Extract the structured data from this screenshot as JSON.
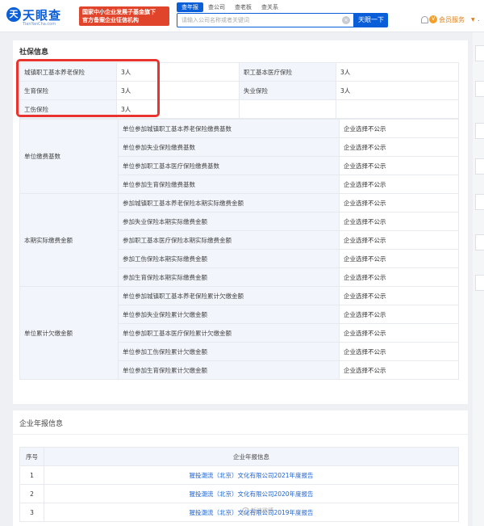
{
  "header": {
    "logo_mark": "天",
    "logo_text": "天眼查",
    "logo_sub": "TianYanCha.com",
    "badge_line1": "国家中小企业发展子基金旗下",
    "badge_line2": "官方备案企业征信机构",
    "search_tabs": [
      "查年报",
      "查公司",
      "查老板",
      "查关系"
    ],
    "search_placeholder": "请输入公司名称或者关键词",
    "clear_glyph": "×",
    "search_button": "天眼一下",
    "vip_icon": "V",
    "vip_label": "会员服务",
    "vip_caret": "▼",
    "user_trunc": "."
  },
  "social_insurance": {
    "title": "社保信息",
    "summary_rows": [
      {
        "label1": "城镇职工基本养老保险",
        "value1": "3人",
        "label2": "职工基本医疗保险",
        "value2": "3人"
      },
      {
        "label1": "生育保险",
        "value1": "3人",
        "label2": "失业保险",
        "value2": "3人"
      },
      {
        "label1": "工伤保险",
        "value1": "3人",
        "label2": "",
        "value2": ""
      }
    ],
    "groups": [
      {
        "name": "单位缴费基数",
        "items": [
          {
            "label": "单位参加城镇职工基本养老保险缴费基数",
            "value": "企业选择不公示"
          },
          {
            "label": "单位参加失业保险缴费基数",
            "value": "企业选择不公示"
          },
          {
            "label": "单位参加职工基本医疗保险缴费基数",
            "value": "企业选择不公示"
          },
          {
            "label": "单位参加生育保险缴费基数",
            "value": "企业选择不公示"
          }
        ]
      },
      {
        "name": "本期实际缴费金额",
        "items": [
          {
            "label": "参加城镇职工基本养老保险本期实际缴费金额",
            "value": "企业选择不公示"
          },
          {
            "label": "参加失业保险本期实际缴费金额",
            "value": "企业选择不公示"
          },
          {
            "label": "参加职工基本医疗保险本期实际缴费金额",
            "value": "企业选择不公示"
          },
          {
            "label": "参加工伤保险本期实际缴费金额",
            "value": "企业选择不公示"
          },
          {
            "label": "参加生育保险本期实际缴费金额",
            "value": "企业选择不公示"
          }
        ]
      },
      {
        "name": "单位累计欠缴金额",
        "items": [
          {
            "label": "单位参加城镇职工基本养老保险累计欠缴金额",
            "value": "企业选择不公示"
          },
          {
            "label": "单位参加失业保险累计欠缴金额",
            "value": "企业选择不公示"
          },
          {
            "label": "单位参加职工基本医疗保险累计欠缴金额",
            "value": "企业选择不公示"
          },
          {
            "label": "单位参加工伤保险累计欠缴金额",
            "value": "企业选择不公示"
          },
          {
            "label": "单位参加生育保险累计欠缴金额",
            "value": "企业选择不公示"
          }
        ]
      }
    ]
  },
  "annual_reports": {
    "title": "企业年报信息",
    "col_index": "序号",
    "col_info": "企业年报信息",
    "rows": [
      {
        "index": "1",
        "title": "猩投潮流（北京）文化有限公司2021年度报告"
      },
      {
        "index": "2",
        "title": "猩投潮流（北京）文化有限公司2020年度报告"
      },
      {
        "index": "3",
        "title": "猩投潮流（北京）文化有限公司2019年度报告"
      }
    ]
  },
  "watermark": "新浪微博"
}
